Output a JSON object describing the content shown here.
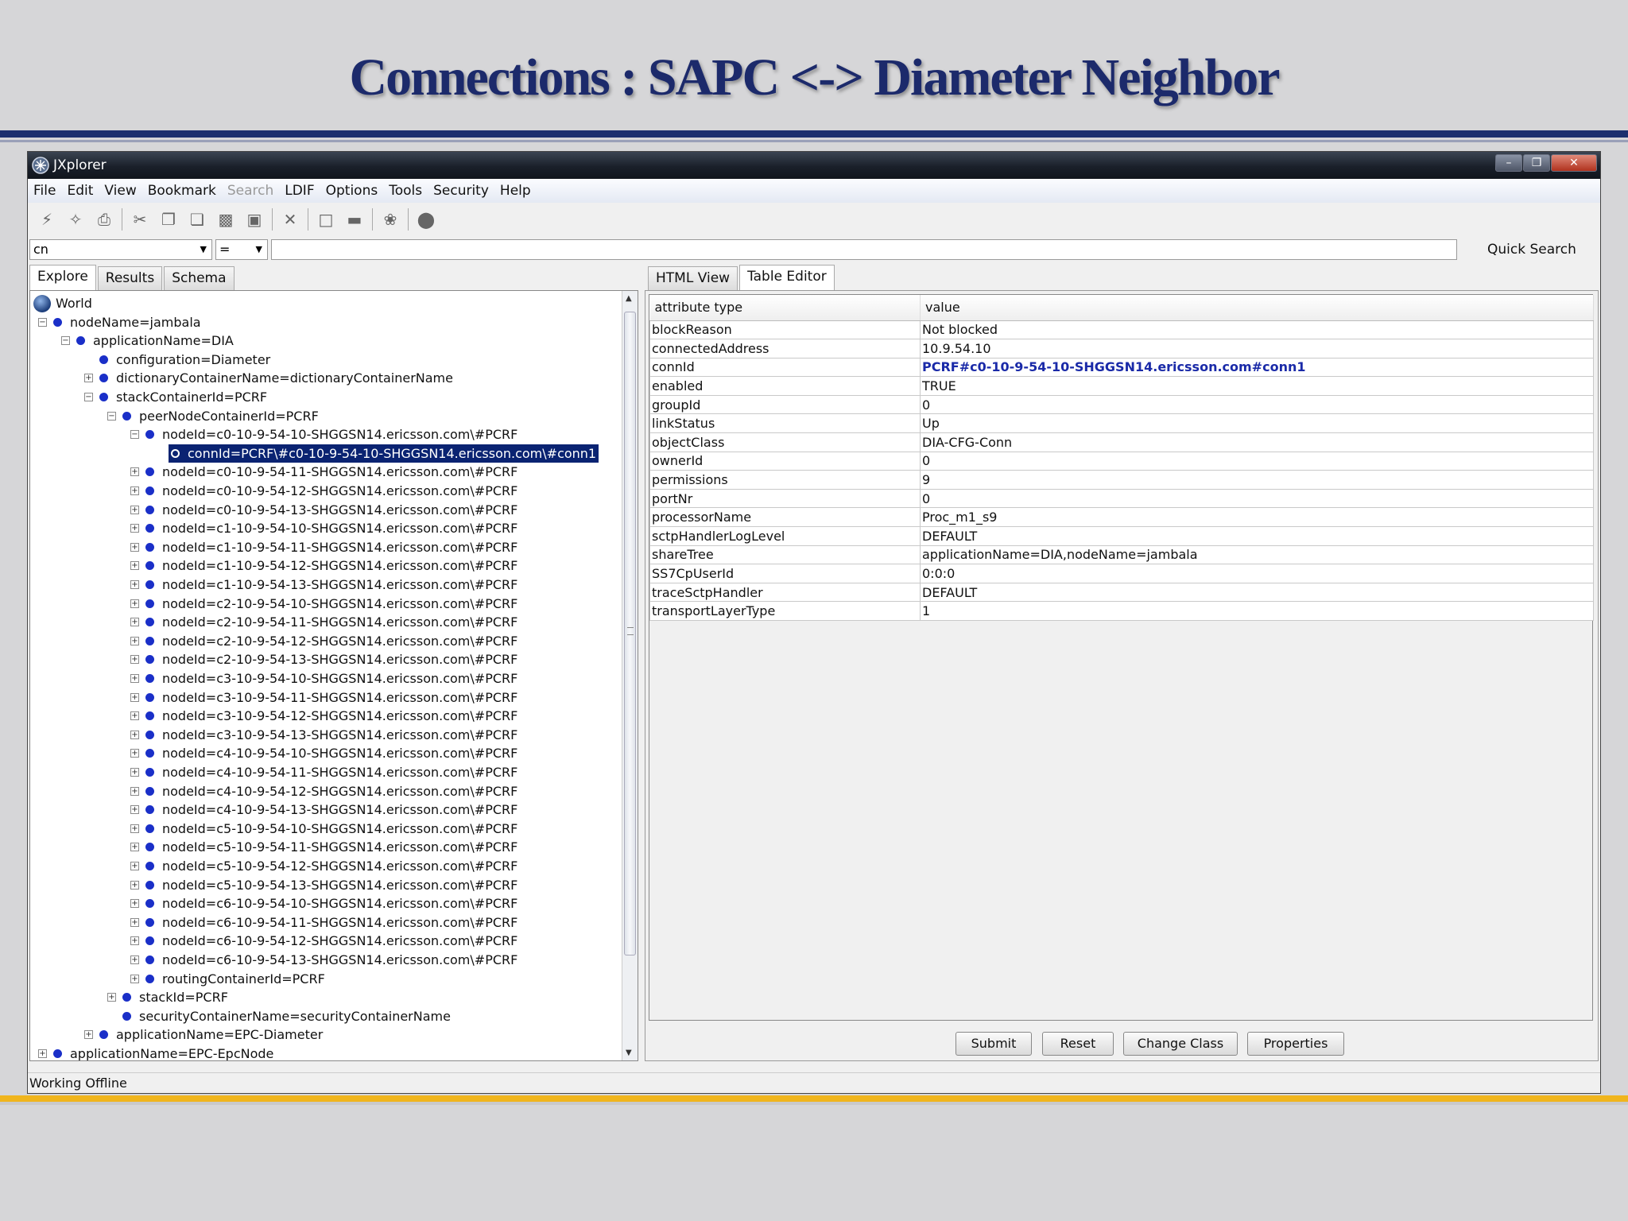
{
  "slide": {
    "title": "Connections : SAPC <-> Diameter Neighbor"
  },
  "window": {
    "title": "JXplorer",
    "icon": "jxplorer-app-icon",
    "controls": [
      "minimize",
      "maximize",
      "close"
    ]
  },
  "menu": [
    "File",
    "Edit",
    "View",
    "Bookmark",
    "Search",
    "LDIF",
    "Options",
    "Tools",
    "Security",
    "Help"
  ],
  "toolbar_icons": [
    "connect-icon",
    "disconnect-icon",
    "print-icon",
    "cut-icon",
    "copy-icon",
    "copy-dn-icon",
    "paste-icon",
    "paste-alias-icon",
    "delete-icon",
    "new-entry-icon",
    "rename-icon",
    "refresh-icon",
    "stop-icon"
  ],
  "search": {
    "attribute": "cn",
    "operator": "=",
    "value": "",
    "quick_search_label": "Quick Search"
  },
  "left_tabs": [
    "Explore",
    "Results",
    "Schema"
  ],
  "tree": {
    "root": "World",
    "nodes": [
      "nodeName=jambala",
      "applicationName=DIA",
      "configuration=Diameter",
      "dictionaryContainerName=dictionaryContainerName",
      "stackContainerId=PCRF",
      "peerNodeContainerId=PCRF",
      "nodeId=c0-10-9-54-10-SHGGSN14.ericsson.com\\#PCRF",
      "connId=PCRF\\#c0-10-9-54-10-SHGGSN14.ericsson.com\\#conn1",
      "nodeId=c0-10-9-54-11-SHGGSN14.ericsson.com\\#PCRF",
      "nodeId=c0-10-9-54-12-SHGGSN14.ericsson.com\\#PCRF",
      "nodeId=c0-10-9-54-13-SHGGSN14.ericsson.com\\#PCRF",
      "nodeId=c1-10-9-54-10-SHGGSN14.ericsson.com\\#PCRF",
      "nodeId=c1-10-9-54-11-SHGGSN14.ericsson.com\\#PCRF",
      "nodeId=c1-10-9-54-12-SHGGSN14.ericsson.com\\#PCRF",
      "nodeId=c1-10-9-54-13-SHGGSN14.ericsson.com\\#PCRF",
      "nodeId=c2-10-9-54-10-SHGGSN14.ericsson.com\\#PCRF",
      "nodeId=c2-10-9-54-11-SHGGSN14.ericsson.com\\#PCRF",
      "nodeId=c2-10-9-54-12-SHGGSN14.ericsson.com\\#PCRF",
      "nodeId=c2-10-9-54-13-SHGGSN14.ericsson.com\\#PCRF",
      "nodeId=c3-10-9-54-10-SHGGSN14.ericsson.com\\#PCRF",
      "nodeId=c3-10-9-54-11-SHGGSN14.ericsson.com\\#PCRF",
      "nodeId=c3-10-9-54-12-SHGGSN14.ericsson.com\\#PCRF",
      "nodeId=c3-10-9-54-13-SHGGSN14.ericsson.com\\#PCRF",
      "nodeId=c4-10-9-54-10-SHGGSN14.ericsson.com\\#PCRF",
      "nodeId=c4-10-9-54-11-SHGGSN14.ericsson.com\\#PCRF",
      "nodeId=c4-10-9-54-12-SHGGSN14.ericsson.com\\#PCRF",
      "nodeId=c4-10-9-54-13-SHGGSN14.ericsson.com\\#PCRF",
      "nodeId=c5-10-9-54-10-SHGGSN14.ericsson.com\\#PCRF",
      "nodeId=c5-10-9-54-11-SHGGSN14.ericsson.com\\#PCRF",
      "nodeId=c5-10-9-54-12-SHGGSN14.ericsson.com\\#PCRF",
      "nodeId=c5-10-9-54-13-SHGGSN14.ericsson.com\\#PCRF",
      "nodeId=c6-10-9-54-10-SHGGSN14.ericsson.com\\#PCRF",
      "nodeId=c6-10-9-54-11-SHGGSN14.ericsson.com\\#PCRF",
      "nodeId=c6-10-9-54-12-SHGGSN14.ericsson.com\\#PCRF",
      "nodeId=c6-10-9-54-13-SHGGSN14.ericsson.com\\#PCRF",
      "routingContainerId=PCRF",
      "stackId=PCRF",
      "securityContainerName=securityContainerName",
      "applicationName=EPC-Diameter",
      "applicationName=EPC-EpcNode"
    ],
    "selected": "connId=PCRF\\#c0-10-9-54-10-SHGGSN14.ericsson.com\\#conn1"
  },
  "right_tabs": [
    "HTML View",
    "Table Editor"
  ],
  "table": {
    "headers": [
      "attribute type",
      "value"
    ],
    "rows": [
      [
        "blockReason",
        "Not blocked"
      ],
      [
        "connectedAddress",
        "10.9.54.10"
      ],
      [
        "connId",
        "PCRF#c0-10-9-54-10-SHGGSN14.ericsson.com#conn1"
      ],
      [
        "enabled",
        "TRUE"
      ],
      [
        "groupId",
        "0"
      ],
      [
        "linkStatus",
        "Up"
      ],
      [
        "objectClass",
        "DIA-CFG-Conn"
      ],
      [
        "ownerId",
        "0"
      ],
      [
        "permissions",
        "9"
      ],
      [
        "portNr",
        "0"
      ],
      [
        "processorName",
        "Proc_m1_s9"
      ],
      [
        "sctpHandlerLogLevel",
        "DEFAULT"
      ],
      [
        "shareTree",
        "applicationName=DIA,nodeName=jambala"
      ],
      [
        "SS7CpUserId",
        "0:0:0"
      ],
      [
        "traceSctpHandler",
        "DEFAULT"
      ],
      [
        "transportLayerType",
        "1"
      ]
    ]
  },
  "buttons": [
    "Submit",
    "Reset",
    "Change Class",
    "Properties"
  ],
  "status": "Working Offline"
}
